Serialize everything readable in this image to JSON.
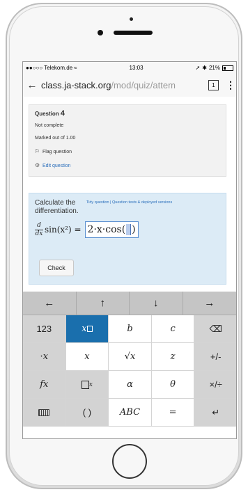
{
  "statusbar": {
    "carrier": "●●○○○ Telekom.de",
    "wifi_icon": "wifi-icon",
    "time": "13:03",
    "battery": "21%"
  },
  "browser": {
    "url_host": "class.ja-stack.org",
    "url_path": "/mod/quiz/attem",
    "tab_count": "1"
  },
  "question": {
    "label": "Question",
    "number": "4",
    "status": "Not complete",
    "marked": "Marked out of 1.00",
    "flag": "Flag question",
    "edit": "Edit question"
  },
  "formulation": {
    "prompt": "Calculate the differentiation.",
    "tidy_link": "Tidy question | Question tests & deployed versions",
    "d": "d",
    "dx": "dx",
    "expression": "sin(x²) =",
    "answer": "2·x·cos(",
    "answer_close": ")",
    "check": "Check"
  },
  "keyboard": {
    "arrows": [
      "←",
      "↑",
      "↓",
      "→"
    ],
    "row1": [
      "123",
      "x□",
      "b",
      "c",
      "⌫"
    ],
    "row2": [
      "·x",
      "x",
      "√x",
      "z",
      "+/-"
    ],
    "row3": [
      "fx",
      "□x",
      "α",
      "θ",
      "×/÷"
    ],
    "row4": [
      "⌨",
      "( )",
      "ABC",
      "=",
      "↵"
    ]
  }
}
